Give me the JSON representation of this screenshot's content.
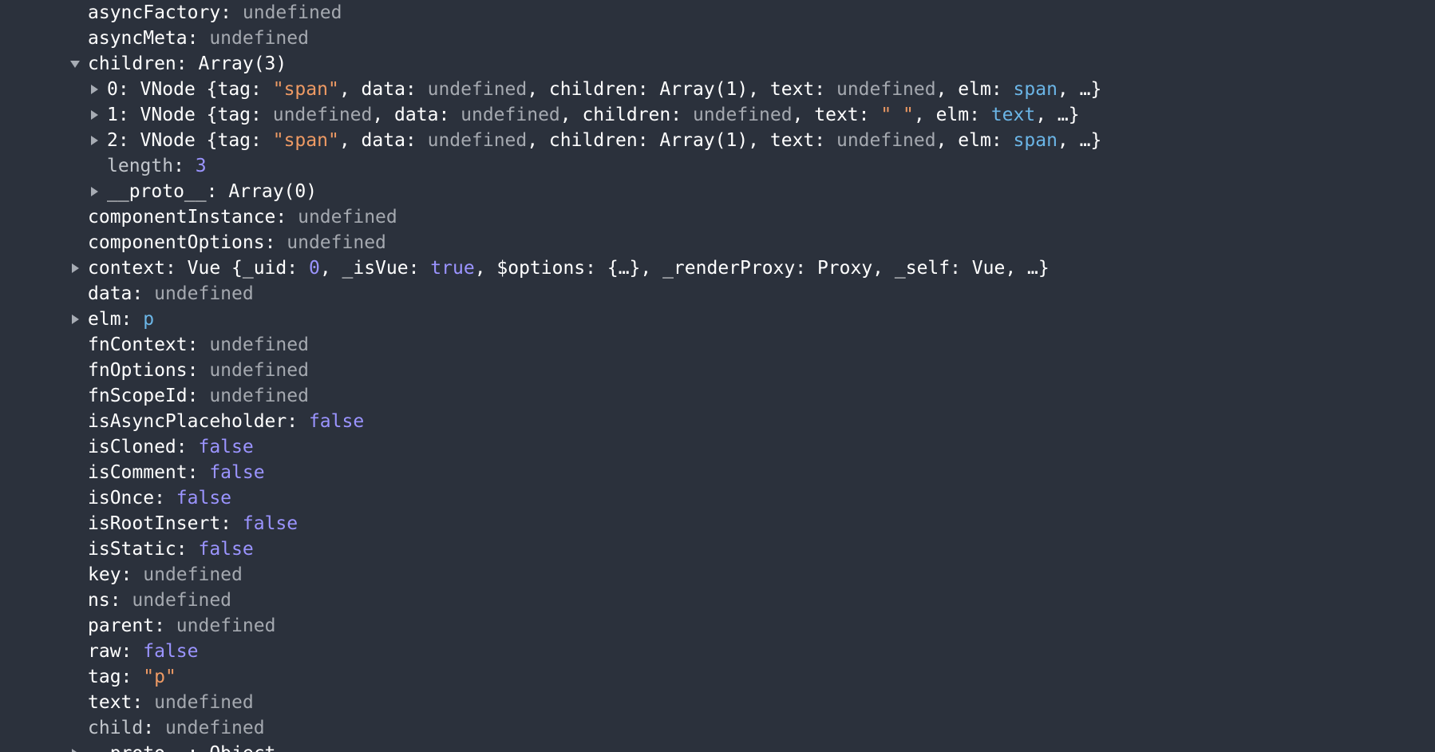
{
  "colors": {
    "background": "#2b313c",
    "key": "#ffffff",
    "dim_key": "#c2c6cc",
    "undefined": "#a5a9b0",
    "string": "#ee9a64",
    "number_boolean": "#9b94ff",
    "dom_node": "#6bb5e6",
    "triangle": "#a7acb4"
  },
  "icons": {
    "expanded": "triangle-down-icon",
    "collapsed": "triangle-right-icon"
  },
  "rows": [
    {
      "indent": 0,
      "toggle": null,
      "name": "prop-asyncFactory",
      "tokens": [
        {
          "t": "asyncFactory",
          "c": "key"
        },
        {
          "t": ": ",
          "c": "p"
        },
        {
          "t": "undefined",
          "c": "undef"
        }
      ]
    },
    {
      "indent": 0,
      "toggle": null,
      "name": "prop-asyncMeta",
      "tokens": [
        {
          "t": "asyncMeta",
          "c": "key"
        },
        {
          "t": ": ",
          "c": "p"
        },
        {
          "t": "undefined",
          "c": "undef"
        }
      ]
    },
    {
      "indent": 0,
      "toggle": "down",
      "name": "prop-children",
      "tokens": [
        {
          "t": "children",
          "c": "key"
        },
        {
          "t": ": Array(3)",
          "c": "p"
        }
      ]
    },
    {
      "indent": 1,
      "toggle": "right",
      "name": "children-item-0",
      "tokens": [
        {
          "t": "0",
          "c": "key"
        },
        {
          "t": ": VNode {tag: ",
          "c": "p"
        },
        {
          "t": "\"span\"",
          "c": "str"
        },
        {
          "t": ", data: ",
          "c": "p"
        },
        {
          "t": "undefined",
          "c": "undef"
        },
        {
          "t": ", children: Array(1), text: ",
          "c": "p"
        },
        {
          "t": "undefined",
          "c": "undef"
        },
        {
          "t": ", elm: ",
          "c": "p"
        },
        {
          "t": "span",
          "c": "node"
        },
        {
          "t": ", …}",
          "c": "p"
        }
      ]
    },
    {
      "indent": 1,
      "toggle": "right",
      "name": "children-item-1",
      "tokens": [
        {
          "t": "1",
          "c": "key"
        },
        {
          "t": ": VNode {tag: ",
          "c": "p"
        },
        {
          "t": "undefined",
          "c": "undef"
        },
        {
          "t": ", data: ",
          "c": "p"
        },
        {
          "t": "undefined",
          "c": "undef"
        },
        {
          "t": ", children: ",
          "c": "p"
        },
        {
          "t": "undefined",
          "c": "undef"
        },
        {
          "t": ", text: ",
          "c": "p"
        },
        {
          "t": "\" \"",
          "c": "str"
        },
        {
          "t": ", elm: ",
          "c": "p"
        },
        {
          "t": "text",
          "c": "node"
        },
        {
          "t": ", …}",
          "c": "p"
        }
      ]
    },
    {
      "indent": 1,
      "toggle": "right",
      "name": "children-item-2",
      "tokens": [
        {
          "t": "2",
          "c": "key"
        },
        {
          "t": ": VNode {tag: ",
          "c": "p"
        },
        {
          "t": "\"span\"",
          "c": "str"
        },
        {
          "t": ", data: ",
          "c": "p"
        },
        {
          "t": "undefined",
          "c": "undef"
        },
        {
          "t": ", children: Array(1), text: ",
          "c": "p"
        },
        {
          "t": "undefined",
          "c": "undef"
        },
        {
          "t": ", elm: ",
          "c": "p"
        },
        {
          "t": "span",
          "c": "node"
        },
        {
          "t": ", …}",
          "c": "p"
        }
      ]
    },
    {
      "indent": 1,
      "toggle": null,
      "name": "children-length",
      "tokens": [
        {
          "t": "length",
          "c": "key dim"
        },
        {
          "t": ": ",
          "c": "p"
        },
        {
          "t": "3",
          "c": "num"
        }
      ]
    },
    {
      "indent": 1,
      "toggle": "right",
      "name": "children-proto",
      "tokens": [
        {
          "t": "__proto__",
          "c": "key"
        },
        {
          "t": ": Array(0)",
          "c": "p"
        }
      ]
    },
    {
      "indent": 0,
      "toggle": null,
      "name": "prop-componentInstance",
      "tokens": [
        {
          "t": "componentInstance",
          "c": "key"
        },
        {
          "t": ": ",
          "c": "p"
        },
        {
          "t": "undefined",
          "c": "undef"
        }
      ]
    },
    {
      "indent": 0,
      "toggle": null,
      "name": "prop-componentOptions",
      "tokens": [
        {
          "t": "componentOptions",
          "c": "key"
        },
        {
          "t": ": ",
          "c": "p"
        },
        {
          "t": "undefined",
          "c": "undef"
        }
      ]
    },
    {
      "indent": 0,
      "toggle": "right",
      "name": "prop-context",
      "tokens": [
        {
          "t": "context",
          "c": "key"
        },
        {
          "t": ": Vue {_uid: ",
          "c": "p"
        },
        {
          "t": "0",
          "c": "num"
        },
        {
          "t": ", _isVue: ",
          "c": "p"
        },
        {
          "t": "true",
          "c": "bool"
        },
        {
          "t": ", $options: {…}, _renderProxy: Proxy, _self: Vue, …}",
          "c": "p"
        }
      ]
    },
    {
      "indent": 0,
      "toggle": null,
      "name": "prop-data",
      "tokens": [
        {
          "t": "data",
          "c": "key"
        },
        {
          "t": ": ",
          "c": "p"
        },
        {
          "t": "undefined",
          "c": "undef"
        }
      ]
    },
    {
      "indent": 0,
      "toggle": "right",
      "name": "prop-elm",
      "tokens": [
        {
          "t": "elm",
          "c": "key"
        },
        {
          "t": ": ",
          "c": "p"
        },
        {
          "t": "p",
          "c": "node"
        }
      ]
    },
    {
      "indent": 0,
      "toggle": null,
      "name": "prop-fnContext",
      "tokens": [
        {
          "t": "fnContext",
          "c": "key"
        },
        {
          "t": ": ",
          "c": "p"
        },
        {
          "t": "undefined",
          "c": "undef"
        }
      ]
    },
    {
      "indent": 0,
      "toggle": null,
      "name": "prop-fnOptions",
      "tokens": [
        {
          "t": "fnOptions",
          "c": "key"
        },
        {
          "t": ": ",
          "c": "p"
        },
        {
          "t": "undefined",
          "c": "undef"
        }
      ]
    },
    {
      "indent": 0,
      "toggle": null,
      "name": "prop-fnScopeId",
      "tokens": [
        {
          "t": "fnScopeId",
          "c": "key"
        },
        {
          "t": ": ",
          "c": "p"
        },
        {
          "t": "undefined",
          "c": "undef"
        }
      ]
    },
    {
      "indent": 0,
      "toggle": null,
      "name": "prop-isAsyncPlaceholder",
      "tokens": [
        {
          "t": "isAsyncPlaceholder",
          "c": "key"
        },
        {
          "t": ": ",
          "c": "p"
        },
        {
          "t": "false",
          "c": "bool"
        }
      ]
    },
    {
      "indent": 0,
      "toggle": null,
      "name": "prop-isCloned",
      "tokens": [
        {
          "t": "isCloned",
          "c": "key"
        },
        {
          "t": ": ",
          "c": "p"
        },
        {
          "t": "false",
          "c": "bool"
        }
      ]
    },
    {
      "indent": 0,
      "toggle": null,
      "name": "prop-isComment",
      "tokens": [
        {
          "t": "isComment",
          "c": "key"
        },
        {
          "t": ": ",
          "c": "p"
        },
        {
          "t": "false",
          "c": "bool"
        }
      ]
    },
    {
      "indent": 0,
      "toggle": null,
      "name": "prop-isOnce",
      "tokens": [
        {
          "t": "isOnce",
          "c": "key"
        },
        {
          "t": ": ",
          "c": "p"
        },
        {
          "t": "false",
          "c": "bool"
        }
      ]
    },
    {
      "indent": 0,
      "toggle": null,
      "name": "prop-isRootInsert",
      "tokens": [
        {
          "t": "isRootInsert",
          "c": "key"
        },
        {
          "t": ": ",
          "c": "p"
        },
        {
          "t": "false",
          "c": "bool"
        }
      ]
    },
    {
      "indent": 0,
      "toggle": null,
      "name": "prop-isStatic",
      "tokens": [
        {
          "t": "isStatic",
          "c": "key"
        },
        {
          "t": ": ",
          "c": "p"
        },
        {
          "t": "false",
          "c": "bool"
        }
      ]
    },
    {
      "indent": 0,
      "toggle": null,
      "name": "prop-key",
      "tokens": [
        {
          "t": "key",
          "c": "key"
        },
        {
          "t": ": ",
          "c": "p"
        },
        {
          "t": "undefined",
          "c": "undef"
        }
      ]
    },
    {
      "indent": 0,
      "toggle": null,
      "name": "prop-ns",
      "tokens": [
        {
          "t": "ns",
          "c": "key"
        },
        {
          "t": ": ",
          "c": "p"
        },
        {
          "t": "undefined",
          "c": "undef"
        }
      ]
    },
    {
      "indent": 0,
      "toggle": null,
      "name": "prop-parent",
      "tokens": [
        {
          "t": "parent",
          "c": "key"
        },
        {
          "t": ": ",
          "c": "p"
        },
        {
          "t": "undefined",
          "c": "undef"
        }
      ]
    },
    {
      "indent": 0,
      "toggle": null,
      "name": "prop-raw",
      "tokens": [
        {
          "t": "raw",
          "c": "key"
        },
        {
          "t": ": ",
          "c": "p"
        },
        {
          "t": "false",
          "c": "bool"
        }
      ]
    },
    {
      "indent": 0,
      "toggle": null,
      "name": "prop-tag",
      "tokens": [
        {
          "t": "tag",
          "c": "key"
        },
        {
          "t": ": ",
          "c": "p"
        },
        {
          "t": "\"p\"",
          "c": "str"
        }
      ]
    },
    {
      "indent": 0,
      "toggle": null,
      "name": "prop-text",
      "tokens": [
        {
          "t": "text",
          "c": "key"
        },
        {
          "t": ": ",
          "c": "p"
        },
        {
          "t": "undefined",
          "c": "undef"
        }
      ]
    },
    {
      "indent": 0,
      "toggle": null,
      "name": "prop-child",
      "tokens": [
        {
          "t": "child",
          "c": "key dim"
        },
        {
          "t": ": ",
          "c": "p"
        },
        {
          "t": "undefined",
          "c": "undef"
        }
      ]
    },
    {
      "indent": 0,
      "toggle": "right",
      "name": "prop-proto",
      "tokens": [
        {
          "t": "__proto__",
          "c": "key"
        },
        {
          "t": ": Object",
          "c": "p"
        }
      ]
    }
  ]
}
